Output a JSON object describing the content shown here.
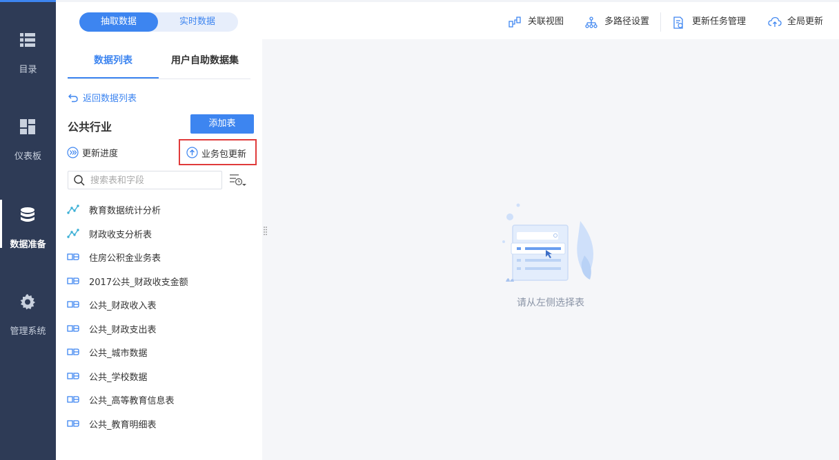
{
  "nav": {
    "items": [
      {
        "label": "目录",
        "icon": "list-icon"
      },
      {
        "label": "仪表板",
        "icon": "dashboard-icon"
      },
      {
        "label": "数据准备",
        "icon": "database-icon"
      },
      {
        "label": "管理系统",
        "icon": "gear-icon"
      }
    ],
    "active_index": 2
  },
  "topbar": {
    "segment": {
      "active": "抽取数据",
      "inactive": "实时数据"
    },
    "tools": [
      {
        "label": "关联视图",
        "icon": "relation-view-icon"
      },
      {
        "label": "多路径设置",
        "icon": "multipath-icon"
      },
      {
        "label": "更新任务管理",
        "icon": "task-manage-icon"
      },
      {
        "label": "全局更新",
        "icon": "cloud-update-icon"
      }
    ]
  },
  "panel": {
    "tabs": [
      "数据列表",
      "用户自助数据集"
    ],
    "back_label": "返回数据列表",
    "group_title": "公共行业",
    "add_table_label": "添加表",
    "progress_label": "更新进度",
    "package_update_label": "业务包更新",
    "search_placeholder": "搜索表和字段",
    "tables": [
      {
        "name": "教育数据统计分析",
        "icon": "analysis-icon"
      },
      {
        "name": "财政收支分析表",
        "icon": "analysis-icon"
      },
      {
        "name": "住房公积金业务表",
        "icon": "db-table-icon"
      },
      {
        "name": "2017公共_财政收支金额",
        "icon": "db-table-icon"
      },
      {
        "name": "公共_财政收入表",
        "icon": "db-table-icon"
      },
      {
        "name": "公共_财政支出表",
        "icon": "db-table-icon"
      },
      {
        "name": "公共_城市数据",
        "icon": "db-table-icon"
      },
      {
        "name": "公共_学校数据",
        "icon": "db-table-icon"
      },
      {
        "name": "公共_高等教育信息表",
        "icon": "db-table-icon"
      },
      {
        "name": "公共_教育明细表",
        "icon": "db-table-icon"
      }
    ]
  },
  "content": {
    "empty_text": "请从左侧选择表"
  },
  "colors": {
    "accent": "#3d85f0",
    "nav_bg": "#2e3b56",
    "highlight_border": "#e03a3a"
  }
}
